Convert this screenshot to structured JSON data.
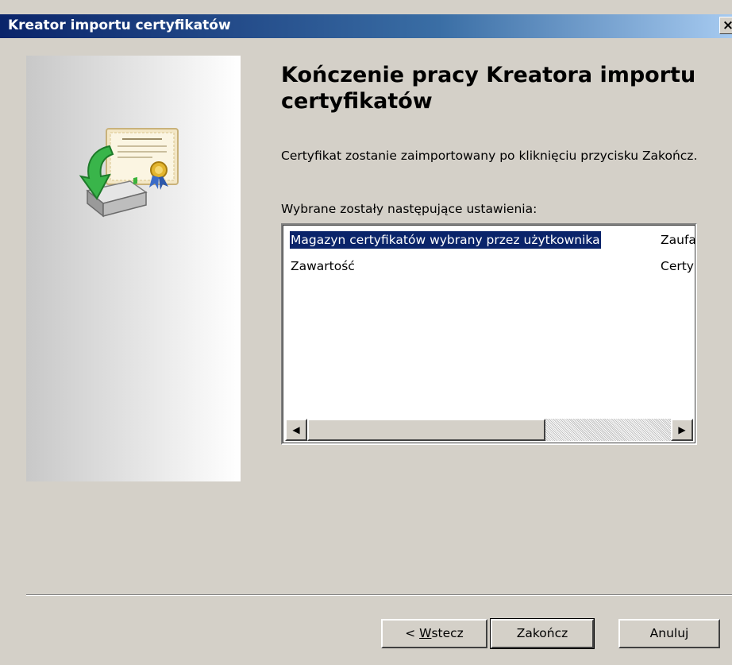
{
  "window": {
    "title": "Kreator importu certyfikatów",
    "close_glyph": "×"
  },
  "side_panel": {
    "graphic_icon": "certificate-import-icon"
  },
  "content": {
    "heading": "Kończenie pracy Kreatora importu certyfikatów",
    "description": "Certyfikat zostanie zaimportowany po kliknięciu przycisku Zakończ.",
    "settings_label": "Wybrane zostały następujące ustawienia:"
  },
  "settings_list": {
    "rows": [
      {
        "name": "Magazyn certyfikatów wybrany przez użytkownika",
        "value": "Zaufa",
        "selected": true
      },
      {
        "name": "Zawartość",
        "value": "Certy",
        "selected": false
      }
    ]
  },
  "scrollbar": {
    "left_glyph": "◀",
    "right_glyph": "▶"
  },
  "buttons": {
    "back_prefix": "< ",
    "back_mnemonic": "W",
    "back_rest": "stecz",
    "finish": "Zakończ",
    "cancel": "Anuluj"
  },
  "colors": {
    "titlebar_start": "#0a246a",
    "titlebar_end": "#a6caf0",
    "selection": "#0a246a",
    "dialog_bg": "#d4d0c8"
  }
}
